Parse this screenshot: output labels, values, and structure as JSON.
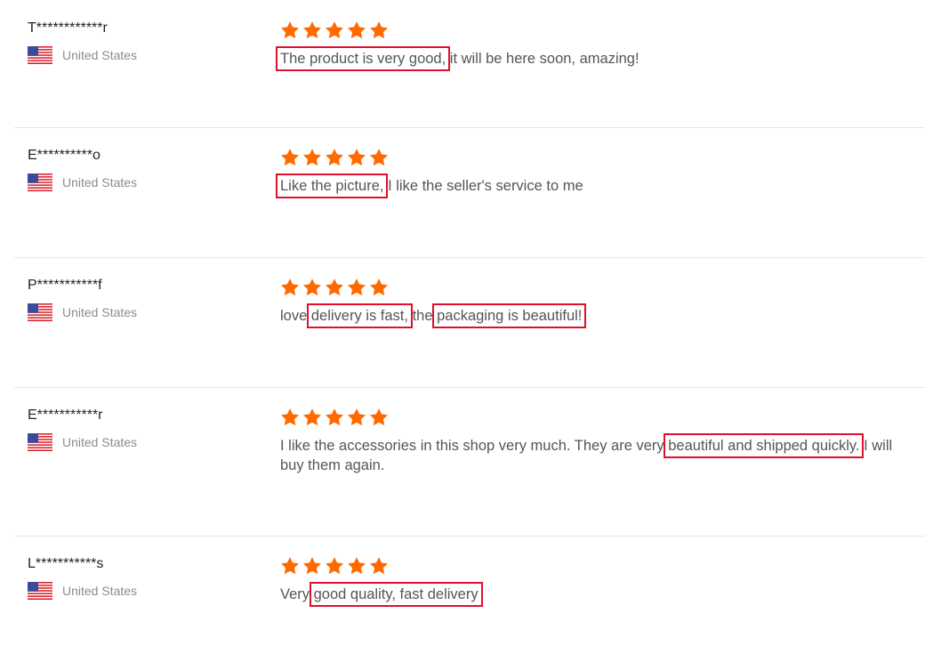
{
  "theme": {
    "star_color": "#ff6a00",
    "highlight_color": "#e0102a",
    "divider_color": "#e6e6e6"
  },
  "reviews": [
    {
      "reviewer": "T************r",
      "country": "United States",
      "flag_icon": "us-flag-icon",
      "rating": 5,
      "text_segments": [
        {
          "text": "The product is very good,",
          "highlight": true
        },
        {
          "text": " it will be here soon, amazing!",
          "highlight": false
        }
      ]
    },
    {
      "reviewer": "E**********o",
      "country": "United States",
      "flag_icon": "us-flag-icon",
      "rating": 5,
      "text_segments": [
        {
          "text": "Like the picture,",
          "highlight": true
        },
        {
          "text": " I like the seller's service to me",
          "highlight": false
        }
      ]
    },
    {
      "reviewer": "P***********f",
      "country": "United States",
      "flag_icon": "us-flag-icon",
      "rating": 5,
      "text_segments": [
        {
          "text": "love ",
          "highlight": false
        },
        {
          "text": "delivery is fast,",
          "highlight": true
        },
        {
          "text": " the ",
          "highlight": false
        },
        {
          "text": "packaging is beautiful!",
          "highlight": true
        }
      ]
    },
    {
      "reviewer": "E***********r",
      "country": "United States",
      "flag_icon": "us-flag-icon",
      "rating": 5,
      "text_segments": [
        {
          "text": "I like the accessories in this shop very much. They are very ",
          "highlight": false
        },
        {
          "text": "beautiful and shipped quickly.",
          "highlight": true
        },
        {
          "text": " I will buy them again.",
          "highlight": false
        }
      ]
    },
    {
      "reviewer": "L***********s",
      "country": "United States",
      "flag_icon": "us-flag-icon",
      "rating": 5,
      "text_segments": [
        {
          "text": "Very ",
          "highlight": false
        },
        {
          "text": "good quality, fast delivery",
          "highlight": true
        }
      ]
    }
  ]
}
